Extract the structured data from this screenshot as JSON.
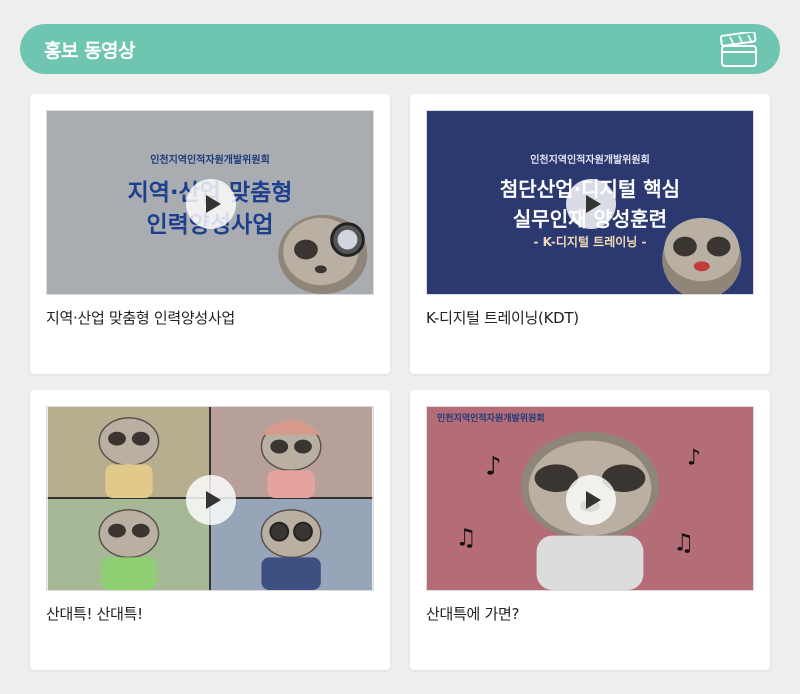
{
  "header": {
    "title": "홍보 동영상",
    "icon": "video-clapper-icon",
    "bg_color": "#6fc6b0"
  },
  "videos": [
    {
      "caption": "지역·산업 맞춤형 인력양성사업",
      "thumb_org": "인천지역인적자원개발위원회",
      "thumb_title_line1": "지역·산업 맞춤형",
      "thumb_title_line2": "인력양성사업"
    },
    {
      "caption": "K-디지털 트레이닝(KDT)",
      "thumb_org": "인천지역인적자원개발위원회",
      "thumb_title_line1": "첨단산업·디지털 핵심",
      "thumb_title_line2": "실무인재 양성훈련",
      "thumb_subtitle": "- K-디지털 트레이닝 -"
    },
    {
      "caption": "산대특! 산대특!"
    },
    {
      "caption": "산대특에 가면?",
      "thumb_org": "인천지역인적자원개발위원회"
    }
  ]
}
